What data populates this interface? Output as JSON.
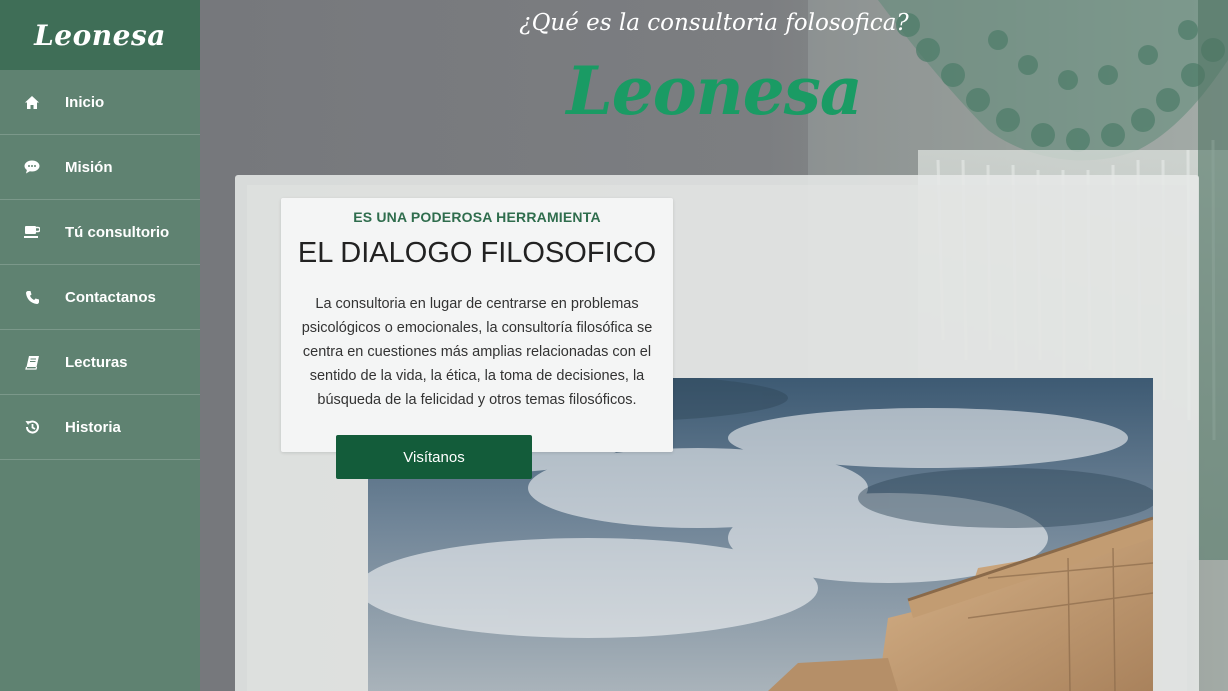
{
  "brand": {
    "name": "Leonesa"
  },
  "sidebar": {
    "items": [
      {
        "label": "Inicio",
        "icon": "home-icon"
      },
      {
        "label": "Misión",
        "icon": "chat-bubble-icon"
      },
      {
        "label": "Tú consultorio",
        "icon": "coffee-cup-icon"
      },
      {
        "label": "Contactanos",
        "icon": "phone-icon"
      },
      {
        "label": "Lecturas",
        "icon": "book-icon"
      },
      {
        "label": "Historia",
        "icon": "history-icon"
      }
    ]
  },
  "hero": {
    "subtitle": "¿Qué es la consultoria folosofica?",
    "logo": "Leonesa"
  },
  "card": {
    "eyebrow": "ES UNA PODEROSA HERRAMIENTA",
    "title": "EL DIALOGO FILOSOFICO",
    "body": "La consultoria en lugar de centrarse en problemas psicológicos o emocionales, la consultoría filosófica se centra en cuestiones más amplias relacionadas con el sentido de la vida, la ética, la toma de decisiones, la búsqueda de la felicidad y otros temas filosóficos.",
    "button_label": "Visítanos"
  },
  "colors": {
    "sidebar": "#5f8271",
    "brand_bar": "#3f6e57",
    "accent_green": "#1a9b64",
    "button": "#135c3a"
  }
}
